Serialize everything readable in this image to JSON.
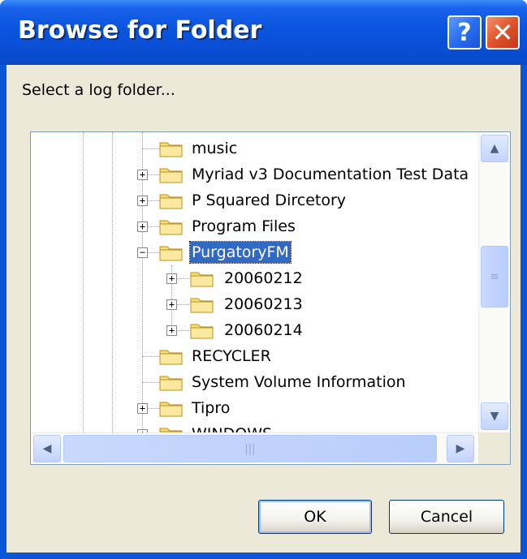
{
  "window": {
    "title": "Browse for Folder",
    "help_label": "?",
    "close_label": "✕"
  },
  "prompt": "Select a log folder...",
  "tree": {
    "items": [
      {
        "label": "music",
        "level": 1,
        "expander": "none",
        "selected": false
      },
      {
        "label": "Myriad v3 Documentation Test Data",
        "level": 1,
        "expander": "+",
        "selected": false
      },
      {
        "label": "P Squared Dircetory",
        "level": 1,
        "expander": "+",
        "selected": false
      },
      {
        "label": "Program Files",
        "level": 1,
        "expander": "+",
        "selected": false
      },
      {
        "label": "PurgatoryFM",
        "level": 1,
        "expander": "−",
        "selected": true
      },
      {
        "label": "20060212",
        "level": 2,
        "expander": "+",
        "selected": false
      },
      {
        "label": "20060213",
        "level": 2,
        "expander": "+",
        "selected": false
      },
      {
        "label": "20060214",
        "level": 2,
        "expander": "+",
        "selected": false
      },
      {
        "label": "RECYCLER",
        "level": 1,
        "expander": "none",
        "selected": false
      },
      {
        "label": "System Volume Information",
        "level": 1,
        "expander": "none",
        "selected": false
      },
      {
        "label": "Tipro",
        "level": 1,
        "expander": "+",
        "selected": false
      },
      {
        "label": "WINDOWS",
        "level": 1,
        "expander": "+",
        "selected": false
      }
    ]
  },
  "scrollbars": {
    "up_icon": "▲",
    "down_icon": "▼",
    "left_icon": "◀",
    "right_icon": "▶",
    "v_grip": "≡",
    "h_grip": "|||"
  },
  "buttons": {
    "ok_label": "OK",
    "cancel_label": "Cancel"
  },
  "colors": {
    "titlebar": "#0a55d8",
    "selection": "#316ac5",
    "dialog_bg": "#ece9d8",
    "close_button": "#e0532a"
  }
}
